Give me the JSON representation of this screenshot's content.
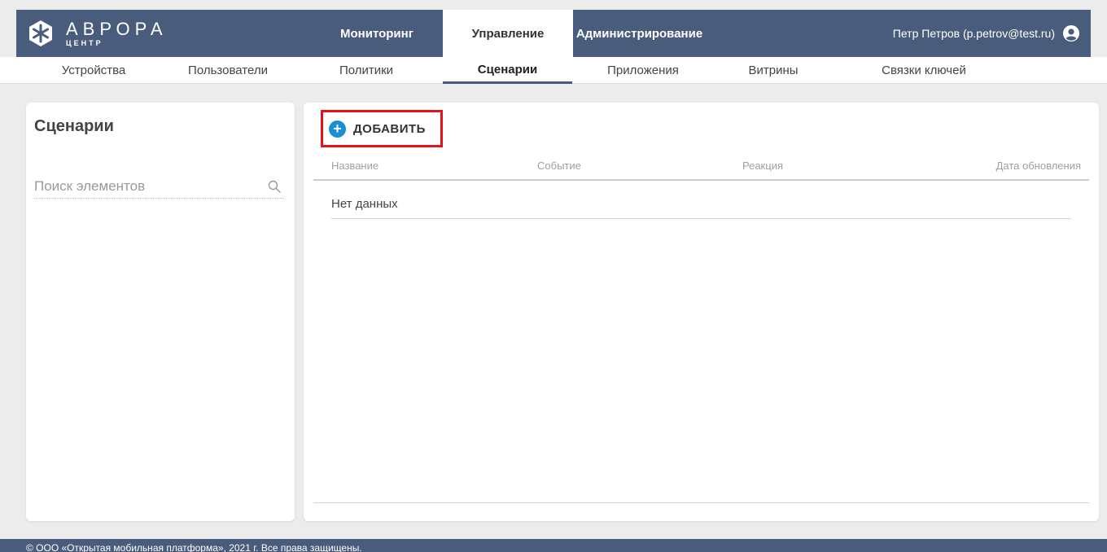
{
  "header": {
    "logo": {
      "title": "АВРОРА",
      "subtitle": "ЦЕНТР",
      "icon": "aurora-star-icon"
    },
    "tabs": [
      {
        "label": "Мониторинг",
        "active": false
      },
      {
        "label": "Управление",
        "active": true
      },
      {
        "label": "Администрирование",
        "active": false
      }
    ],
    "user": {
      "label": "Петр Петров (p.petrov@test.ru)",
      "icon": "user-circle-icon"
    }
  },
  "subnav": {
    "items": [
      {
        "label": "Устройства",
        "active": false
      },
      {
        "label": "Пользователи",
        "active": false
      },
      {
        "label": "Политики",
        "active": false
      },
      {
        "label": "Сценарии",
        "active": true
      },
      {
        "label": "Приложения",
        "active": false
      },
      {
        "label": "Витрины",
        "active": false
      },
      {
        "label": "Связки ключей",
        "active": false
      }
    ]
  },
  "sidebar": {
    "title": "Сценарии",
    "search": {
      "placeholder": "Поиск элементов",
      "value": "",
      "icon": "search-icon"
    }
  },
  "main": {
    "add_button": {
      "label": "ДОБАВИТЬ",
      "icon": "plus-circle-icon"
    },
    "table": {
      "columns": [
        "Название",
        "Событие",
        "Реакция",
        "Дата обновления"
      ],
      "rows": [],
      "empty_text": "Нет данных"
    }
  },
  "footer": {
    "text": "© ООО «Открытая мобильная платформа», 2021 г. Все права защищены."
  },
  "colors": {
    "header_bg": "#4a5c7b",
    "accent": "#1a8fd1",
    "highlight": "#e3131b"
  }
}
